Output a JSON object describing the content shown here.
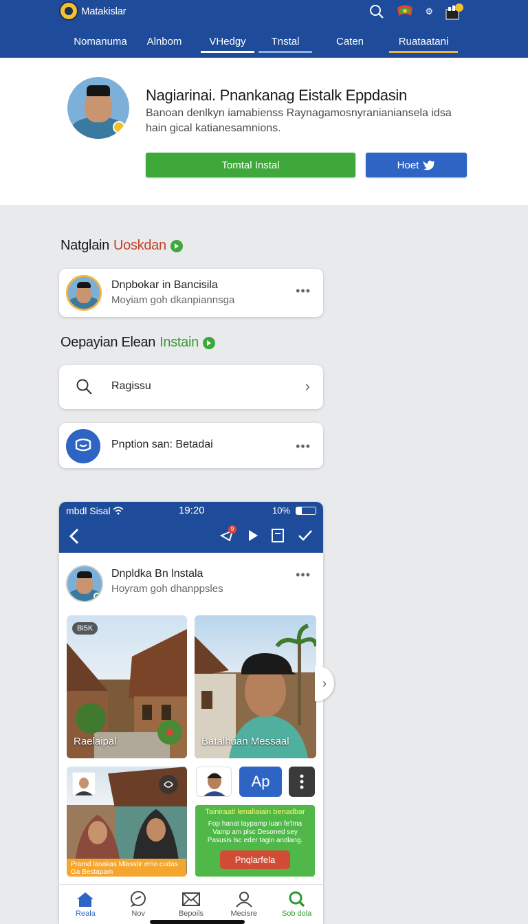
{
  "header": {
    "brand": "Matakislar",
    "tabs": [
      {
        "label": "Nomanuma"
      },
      {
        "label": "Alnbom"
      },
      {
        "label": "VHedgy"
      },
      {
        "label": "Tnstal"
      },
      {
        "label": "Caten"
      },
      {
        "label": "Ruataatani"
      }
    ],
    "icons": [
      "search-icon",
      "flag-badge-icon",
      "settings-dot-icon",
      "notification-cart-icon"
    ],
    "badge_char": "⚙"
  },
  "profile": {
    "name": "Nagiarinai. Pnankanag Eistalk Eppdasin",
    "description": "Banoan denlkyn iamabienss Raynagamosnyranianiansela idsa hain gical katianesamnions.",
    "primary_button": "Tomtal Instal",
    "secondary_button": "Hoet"
  },
  "section1": {
    "title_prefix": "Natglain",
    "title_accent": "Uoskdan",
    "card": {
      "title": "Dnpbokar in Bancisila",
      "subtitle": "Moyiam goh dkanpiannsga",
      "more": "•••"
    }
  },
  "section2": {
    "title_prefix": "Oepayian Elean",
    "title_accent": "Instain",
    "search_card": {
      "label": "Ragissu",
      "chevron": "›"
    },
    "option_card": {
      "label": "Pnption san: Betadai",
      "more": "•••"
    }
  },
  "phone": {
    "status": {
      "carrier": "mbdl Sisal",
      "time": "19:20",
      "battery": "10%"
    },
    "notif_count": "9",
    "post": {
      "name": "Dnpldka Bn lnstala",
      "subtitle": "Hoyram goh dhanppsles",
      "more": "•••"
    },
    "tiles": [
      {
        "badge": "Bi5K",
        "caption": "Raelaipal"
      },
      {
        "caption": "Batalhuan Messaal"
      }
    ],
    "promo": {
      "head": "Tainiraatl lenallaiain benadbar",
      "body": "Fop hanat laypamp luan fe'lma Vamp am plsc Desoned sey Pasusis lsc eder tagin andlang.",
      "button": "Pnqlarfela"
    },
    "orange_bar": "Pramd laoakas Mlasstir emo cudas Ga Bestapam",
    "app_btn": "Ap",
    "bottom_nav": [
      {
        "label": "Reala"
      },
      {
        "label": "Nov"
      },
      {
        "label": "Bepoils"
      },
      {
        "label": "Mecisre"
      },
      {
        "label": "Sob dola"
      }
    ]
  },
  "colors": {
    "header_blue": "#1e4c9a",
    "green": "#3ea83a",
    "blue_button": "#2e65c4",
    "accent_red": "#c5412a",
    "orange": "#f4a62e"
  }
}
